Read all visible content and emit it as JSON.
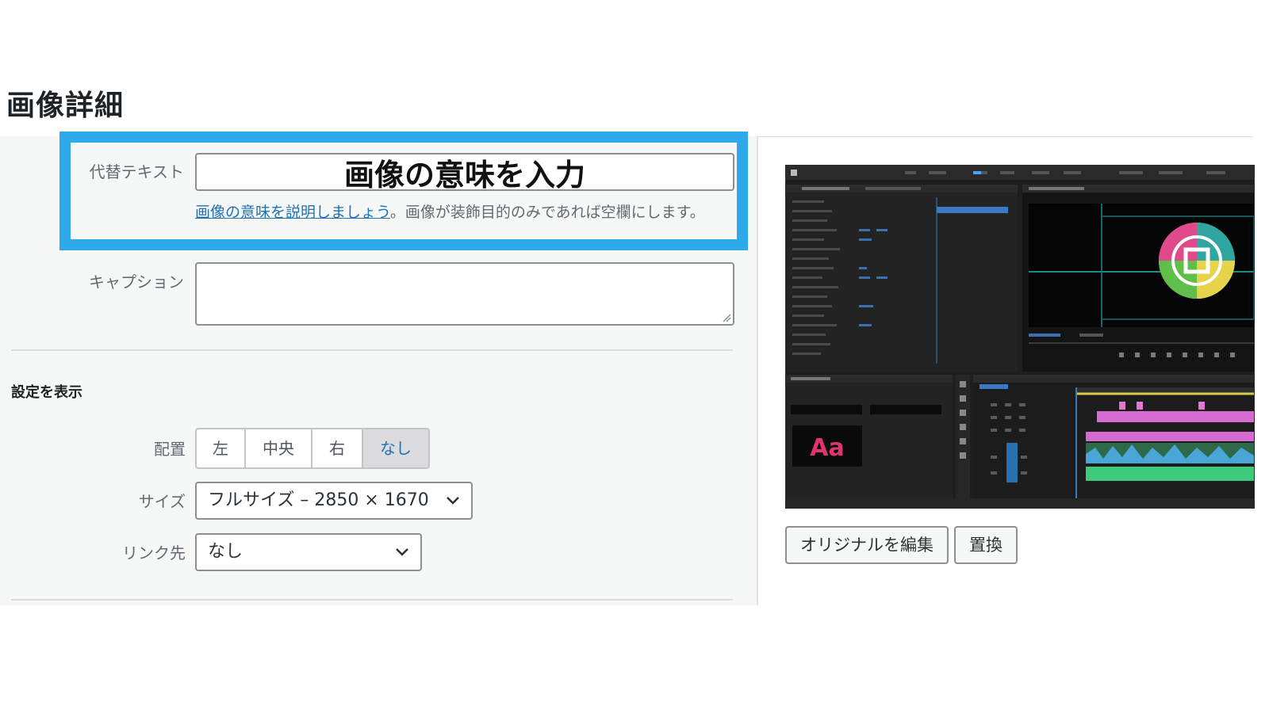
{
  "page_title": "画像詳細",
  "alt_text": {
    "label": "代替テキスト",
    "value": "画像の意味を入力",
    "help_link": "画像の意味を説明しましょう",
    "help_rest": "。画像が装飾目的のみであれば空欄にします。"
  },
  "caption": {
    "label": "キャプション",
    "value": ""
  },
  "display_settings": {
    "title": "設定を表示",
    "alignment": {
      "label": "配置",
      "options": [
        "左",
        "中央",
        "右",
        "なし"
      ],
      "selected": "なし"
    },
    "size": {
      "label": "サイズ",
      "value": "フルサイズ – 2850 × 1670"
    },
    "link_to": {
      "label": "リンク先",
      "value": "なし"
    }
  },
  "preview": {
    "thumb_label": "Aa"
  },
  "actions": {
    "edit_original": "オリジナルを編集",
    "replace": "置換"
  },
  "colors": {
    "highlight": "#2ea9ea",
    "link": "#2271b1",
    "panel_bg": "#f6f7f7"
  }
}
